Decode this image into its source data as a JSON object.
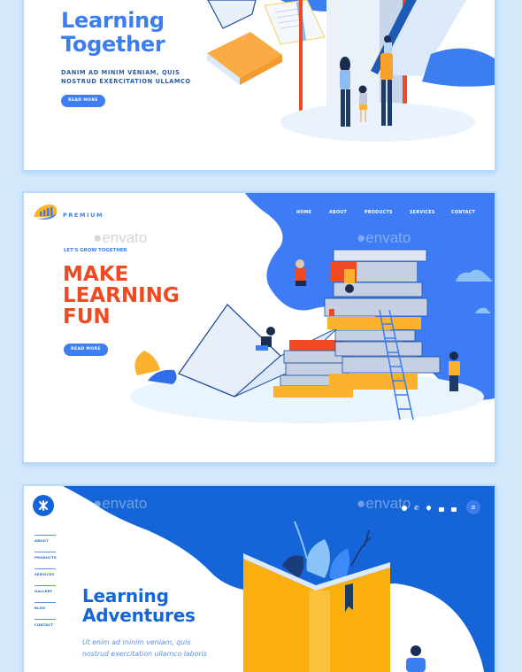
{
  "colors": {
    "page_background": "#d3e8fb",
    "primary_blue": "#3c7df0",
    "deep_blue": "#1565d8",
    "accent_red": "#f04a23",
    "accent_orange": "#fcb22c"
  },
  "card1": {
    "title_line1": "Learning",
    "title_line2": "Together",
    "subtitle_line1": "DANIM AD MINIM VENIAM, QUIS",
    "subtitle_line2": "NOSTRUD EXERCITATION ULLAMCO",
    "button_label": "READ MORE"
  },
  "card2": {
    "brand": "PREMIUM",
    "nav": [
      "HOME",
      "ABOUT",
      "PRODUCTS",
      "SERVICES",
      "CONTACT"
    ],
    "eyebrow": "LET'S GROW TOGETHER",
    "title_line1": "MAKE",
    "title_line2": "LEARNING",
    "title_line3": "FUN",
    "button_label": "READ MORE",
    "watermark": "envato"
  },
  "card3": {
    "nav": [
      "ABOUT",
      "PRODUCTS",
      "SERVICES",
      "GALLERY",
      "BLOG",
      "CONTACT"
    ],
    "title_line1": "Learning",
    "title_line2": "Adventures",
    "text_line1": "Ut enim ad minim veniam, quis",
    "text_line2": "nostrud exercitation ullamco laboris",
    "watermark": "envato",
    "top_icons": [
      "globe-icon",
      "phone-icon",
      "location-pin-icon",
      "video-icon",
      "mail-icon"
    ],
    "menu_icon": "hamburger-menu-icon"
  }
}
